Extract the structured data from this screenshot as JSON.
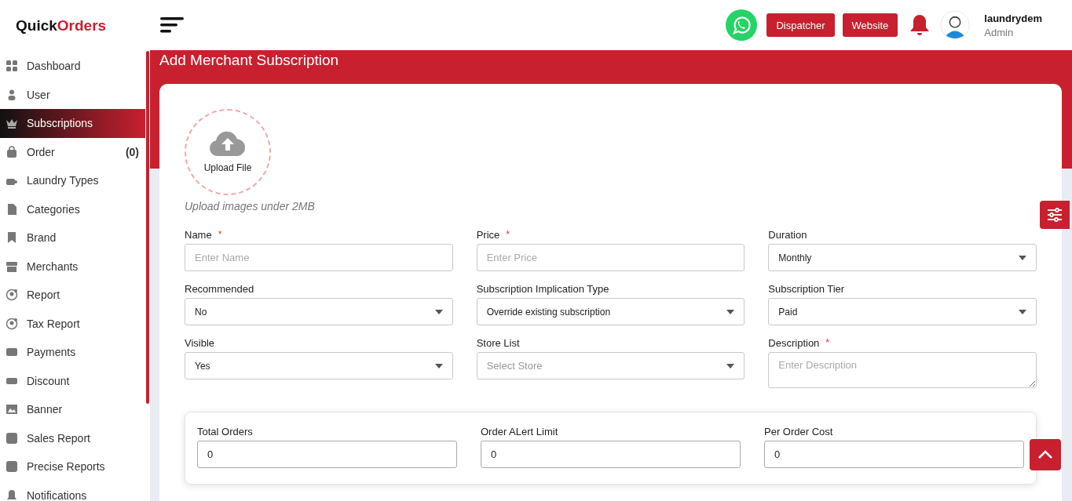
{
  "brand": {
    "first": "Quick",
    "second": "Orders"
  },
  "sidebar": {
    "items": [
      {
        "label": "Dashboard",
        "selected": false
      },
      {
        "label": "User",
        "selected": false
      },
      {
        "label": "Subscriptions",
        "selected": true
      },
      {
        "label": "Order",
        "selected": false,
        "count": "(0)"
      },
      {
        "label": "Laundry Types",
        "selected": false
      },
      {
        "label": "Categories",
        "selected": false
      },
      {
        "label": "Brand",
        "selected": false
      },
      {
        "label": "Merchants",
        "selected": false
      },
      {
        "label": "Report",
        "selected": false
      },
      {
        "label": "Tax Report",
        "selected": false
      },
      {
        "label": "Payments",
        "selected": false
      },
      {
        "label": "Discount",
        "selected": false
      },
      {
        "label": "Banner",
        "selected": false
      },
      {
        "label": "Sales Report",
        "selected": false
      },
      {
        "label": "Precise Reports",
        "selected": false
      },
      {
        "label": "Notifications",
        "selected": false
      }
    ]
  },
  "header": {
    "buttons": [
      "Dispatcher",
      "Website"
    ],
    "user": {
      "name": "laundrydem",
      "role": "Admin"
    }
  },
  "page_title": "Add Merchant Subscription",
  "upload": {
    "label": "Upload File",
    "hint": "Upload images under 2MB"
  },
  "fields": [
    {
      "label": "Name",
      "required_mark": "*",
      "kind": "input",
      "placeholder": "Enter Name"
    },
    {
      "label": "Price",
      "required_mark": "*",
      "kind": "input",
      "placeholder": "Enter Price"
    },
    {
      "label": "Duration",
      "kind": "select",
      "value": "Monthly"
    },
    {
      "label": "Recommended",
      "kind": "select",
      "value": "No"
    },
    {
      "label": "Subscription Implication Type",
      "kind": "select",
      "value": "Override existing subscription"
    },
    {
      "label": "Subscription Tier",
      "kind": "select",
      "value": "Paid"
    },
    {
      "label": "Visible",
      "kind": "select",
      "value": "Yes"
    },
    {
      "label": "Store List",
      "kind": "select",
      "placeholder": "Select Store"
    },
    {
      "label": "Description",
      "required_mark": "*",
      "kind": "textarea",
      "placeholder": "Enter Description"
    }
  ],
  "limits": [
    {
      "label": "Total Orders",
      "value": "0"
    },
    {
      "label": "Order ALert Limit",
      "value": "0"
    },
    {
      "label": "Per Order Cost",
      "value": "0"
    }
  ]
}
